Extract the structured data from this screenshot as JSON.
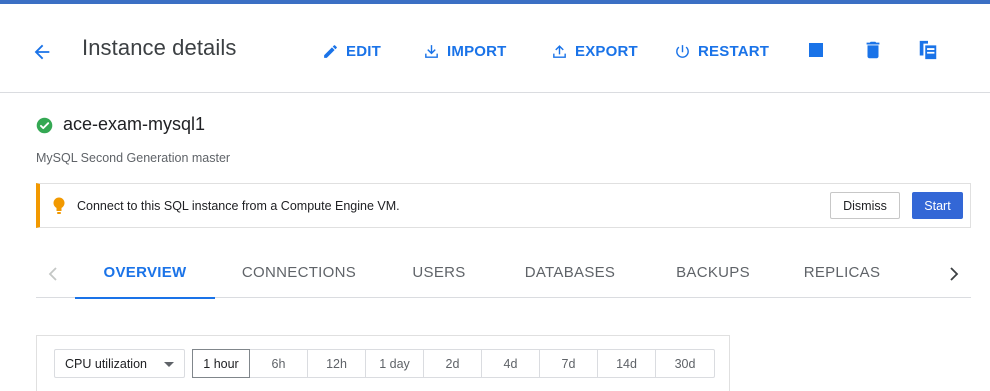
{
  "header": {
    "title": "Instance details",
    "buttons": {
      "edit": "EDIT",
      "import": "IMPORT",
      "export": "EXPORT",
      "restart": "RESTART"
    },
    "icon_buttons": [
      "stop-icon",
      "delete-icon",
      "clone-icon"
    ]
  },
  "instance": {
    "status_icon": "check-circle-icon",
    "status_color": "#34a853",
    "name": "ace-exam-mysql1",
    "subtitle": "MySQL Second Generation master"
  },
  "banner": {
    "icon": "lightbulb-icon",
    "accent_color": "#f29900",
    "text": "Connect to this SQL instance from a Compute Engine VM.",
    "dismiss_label": "Dismiss",
    "start_label": "Start"
  },
  "tabs": {
    "items": [
      "OVERVIEW",
      "CONNECTIONS",
      "USERS",
      "DATABASES",
      "BACKUPS",
      "REPLICAS"
    ],
    "active": "OVERVIEW"
  },
  "chart_controls": {
    "metric": "CPU utilization",
    "ranges": [
      "1 hour",
      "6h",
      "12h",
      "1 day",
      "2d",
      "4d",
      "7d",
      "14d",
      "30d"
    ],
    "selected_range": "1 hour"
  },
  "colors": {
    "accent": "#1a73e8",
    "primary_button": "#3367d6",
    "top_bar": "#3b6fc4"
  }
}
